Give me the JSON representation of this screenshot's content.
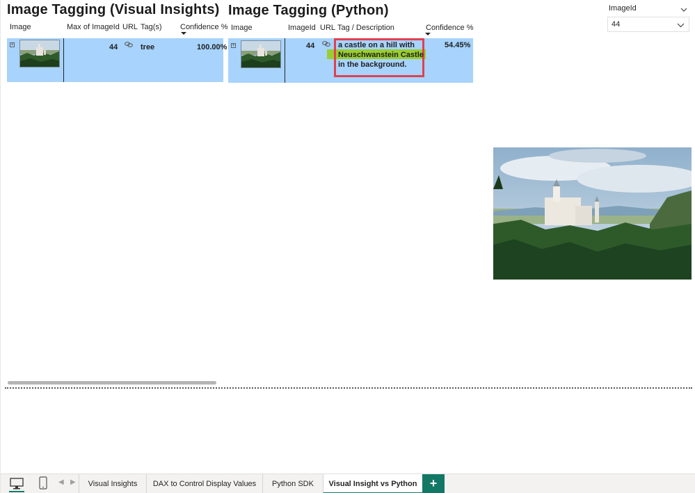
{
  "titles": {
    "visual": "Image Tagging (Visual Insights)",
    "python": "Image Tagging (Python)"
  },
  "visual_table": {
    "headers": [
      "Image",
      "Max of ImageId",
      "URL",
      "Tag(s)",
      "Confidence %"
    ],
    "rows": [
      {
        "image_id": "44",
        "tag": "tree",
        "confidence": "100.00%"
      }
    ]
  },
  "python_table": {
    "headers": [
      "Image",
      "ImageId",
      "URL",
      "Tag / Description",
      "Confidence %"
    ],
    "rows": [
      {
        "image_id": "44",
        "description_lines": [
          "a castle on a hill with",
          "Neuschwanstein Castle",
          "in the background."
        ],
        "confidence": "54.45%"
      }
    ]
  },
  "slicer": {
    "title": "ImageId",
    "value": "44"
  },
  "tabs": [
    {
      "label": "Visual Insights",
      "active": false
    },
    {
      "label": "DAX to Control Display Values",
      "active": false
    },
    {
      "label": "Python SDK",
      "active": false
    },
    {
      "label": "Visual Insight vs Python",
      "active": true
    }
  ],
  "add_tab_label": "+",
  "colors": {
    "row_selected": "#a7d3fc",
    "highlight_box": "#e0414f",
    "highlight_fill": "#9acd32",
    "accent": "#117865"
  },
  "icons": {
    "url": "link-icon",
    "expand": "expand-icon",
    "chevron": "chevron-down-icon",
    "desktop": "desktop-icon",
    "phone": "phone-icon"
  }
}
